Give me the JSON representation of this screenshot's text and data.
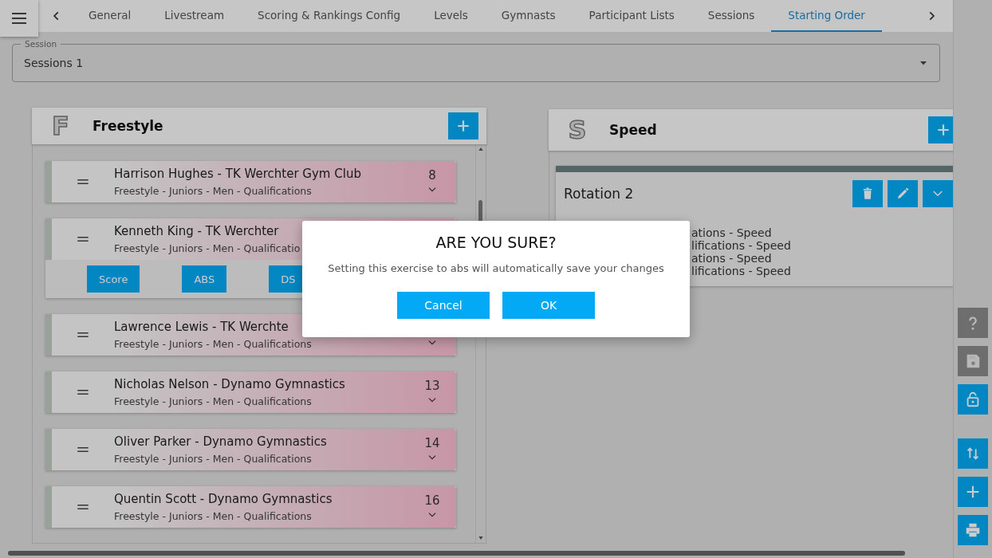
{
  "tabs": [
    {
      "label": "General",
      "selected": false
    },
    {
      "label": "Livestream",
      "selected": false
    },
    {
      "label": "Scoring & Rankings Config",
      "selected": false
    },
    {
      "label": "Levels",
      "selected": false
    },
    {
      "label": "Gymnasts",
      "selected": false
    },
    {
      "label": "Participant Lists",
      "selected": false
    },
    {
      "label": "Sessions",
      "selected": false
    },
    {
      "label": "Starting Order",
      "selected": true
    }
  ],
  "session_field": {
    "label": "Session",
    "value": "Sessions 1"
  },
  "freestyle_panel": {
    "letter": "F",
    "title": "Freestyle",
    "entries": [
      {
        "name": "Harrison Hughes - TK Werchter Gym Club",
        "detail": "Freestyle - Juniors - Men - Qualifications",
        "number": "8",
        "expanded": false
      },
      {
        "name": "Kenneth King - TK Werchter",
        "detail": "Freestyle - Juniors - Men - Qualificatio",
        "expanded": true,
        "actions": [
          "Score",
          "ABS",
          "DS"
        ]
      },
      {
        "name": "Lawrence Lewis - TK Werchte",
        "detail": "Freestyle - Juniors - Men - Qualifications",
        "expanded": false
      },
      {
        "name": "Nicholas Nelson - Dynamo Gymnastics",
        "detail": "Freestyle - Juniors - Men - Qualifications",
        "number": "13",
        "expanded": false
      },
      {
        "name": "Oliver Parker - Dynamo Gymnastics",
        "detail": "Freestyle - Juniors - Men - Qualifications",
        "number": "14",
        "expanded": false
      },
      {
        "name": "Quentin Scott - Dynamo Gymnastics",
        "detail": "Freestyle - Juniors - Men - Qualifications",
        "number": "16",
        "expanded": false
      }
    ]
  },
  "speed_panel": {
    "letter": "S",
    "title": "Speed",
    "rotation": {
      "title": "Rotation 2",
      "lines": [
        "ations - Speed",
        "lifications - Speed",
        "ations - Speed",
        "lifications - Speed"
      ]
    }
  },
  "sidebar_buttons": [
    {
      "kind": "help",
      "disabled": true
    },
    {
      "kind": "save",
      "disabled": true
    },
    {
      "kind": "unlock",
      "disabled": false
    },
    {
      "kind": "sort",
      "disabled": false
    },
    {
      "kind": "add",
      "disabled": false
    },
    {
      "kind": "print",
      "disabled": false
    }
  ],
  "dialog": {
    "title": "ARE YOU SURE?",
    "message": "Setting this exercise to abs will automatically save your changes",
    "buttons": [
      "Cancel",
      "OK"
    ]
  }
}
